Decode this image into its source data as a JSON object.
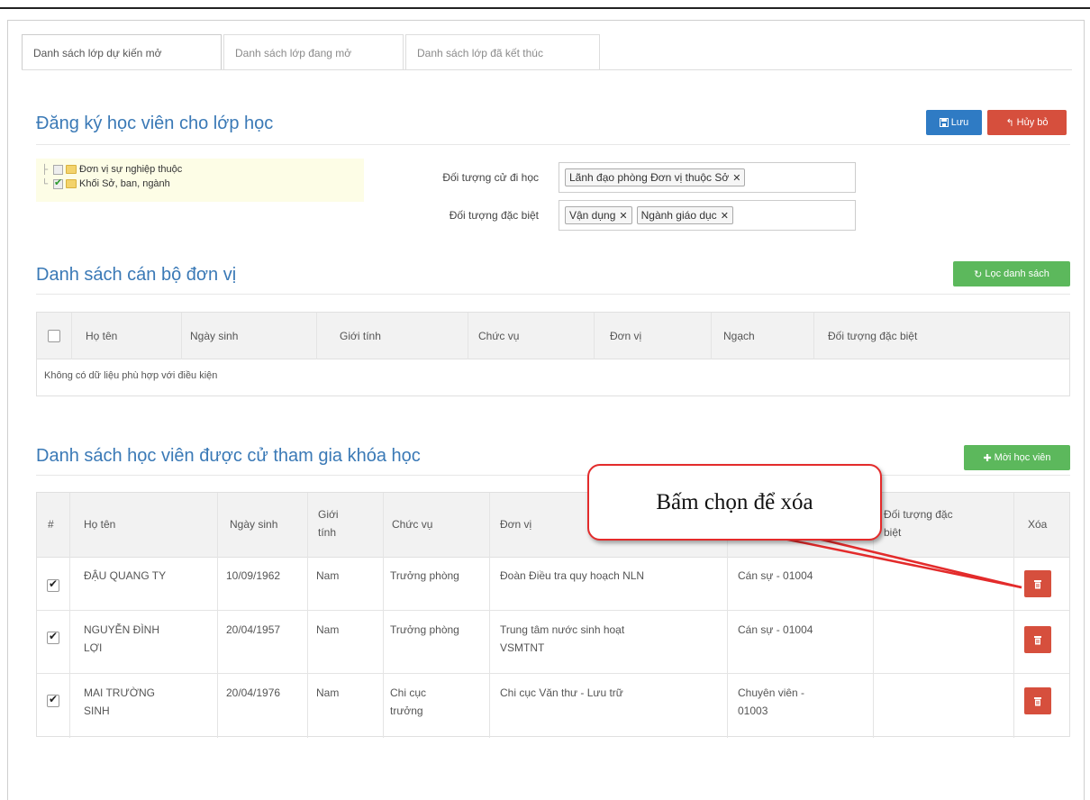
{
  "tabs": [
    {
      "label": "Danh sách lớp dự kiến mở",
      "active": true
    },
    {
      "label": "Danh sách lớp đang mở",
      "active": false
    },
    {
      "label": "Danh sách lớp đã kết thúc",
      "active": false
    }
  ],
  "register": {
    "title": "Đăng ký học viên cho lớp học",
    "save_label": "Lưu",
    "cancel_label": "Hủy bỏ",
    "tree": [
      {
        "label": "Đơn vị sự nghiệp thuộc",
        "checked": false
      },
      {
        "label": "Khối Sở, ban, ngành",
        "checked": true
      }
    ],
    "sent_label": "Đối tượng cử đi học",
    "sent_tags": [
      "Lãnh đạo phòng Đơn vị thuộc Sở"
    ],
    "special_label": "Đối tượng đặc biệt",
    "special_tags": [
      "Vận dụng",
      "Ngành giáo dục"
    ]
  },
  "staff": {
    "title": "Danh sách cán bộ đơn vị",
    "filter_label": "Lọc danh sách",
    "columns": [
      "Họ tên",
      "Ngày sinh",
      "Giới tính",
      "Chức vụ",
      "Đơn vị",
      "Ngạch",
      "Đối tượng đặc biệt"
    ],
    "empty_text": "Không có dữ liệu phù hợp với điều kiện"
  },
  "students": {
    "title": "Danh sách học viên được cử tham gia khóa học",
    "invite_label": "Mời học viên",
    "columns": {
      "index": "#",
      "name": "Họ tên",
      "dob": "Ngày sinh",
      "gender": "Giới\ntính",
      "position": "Chức vụ",
      "unit": "Đơn vị",
      "rank": "",
      "special": "Đối tượng đặc\nbiệt",
      "delete": "Xóa"
    },
    "rows": [
      {
        "name": "ĐẬU QUANG TY",
        "dob": "10/09/1962",
        "gender": "Nam",
        "position": "Trưởng phòng",
        "unit": "Đoàn Điều tra quy hoạch NLN",
        "rank": "Cán sự - 01004"
      },
      {
        "name": "NGUYỄN ĐÌNH\nLỢI",
        "dob": "20/04/1957",
        "gender": "Nam",
        "position": "Trưởng phòng",
        "unit": "Trung tâm nước sinh hoạt\nVSMTNT",
        "rank": "Cán sự - 01004"
      },
      {
        "name": "MAI TRƯỜNG\nSINH",
        "dob": "20/04/1976",
        "gender": "Nam",
        "position": "Chi cục\ntrưởng",
        "unit": "Chi cục Văn thư - Lưu trữ",
        "rank": "Chuyên viên -\n01003"
      }
    ]
  },
  "callout": {
    "text": "Bấm chọn để xóa"
  }
}
